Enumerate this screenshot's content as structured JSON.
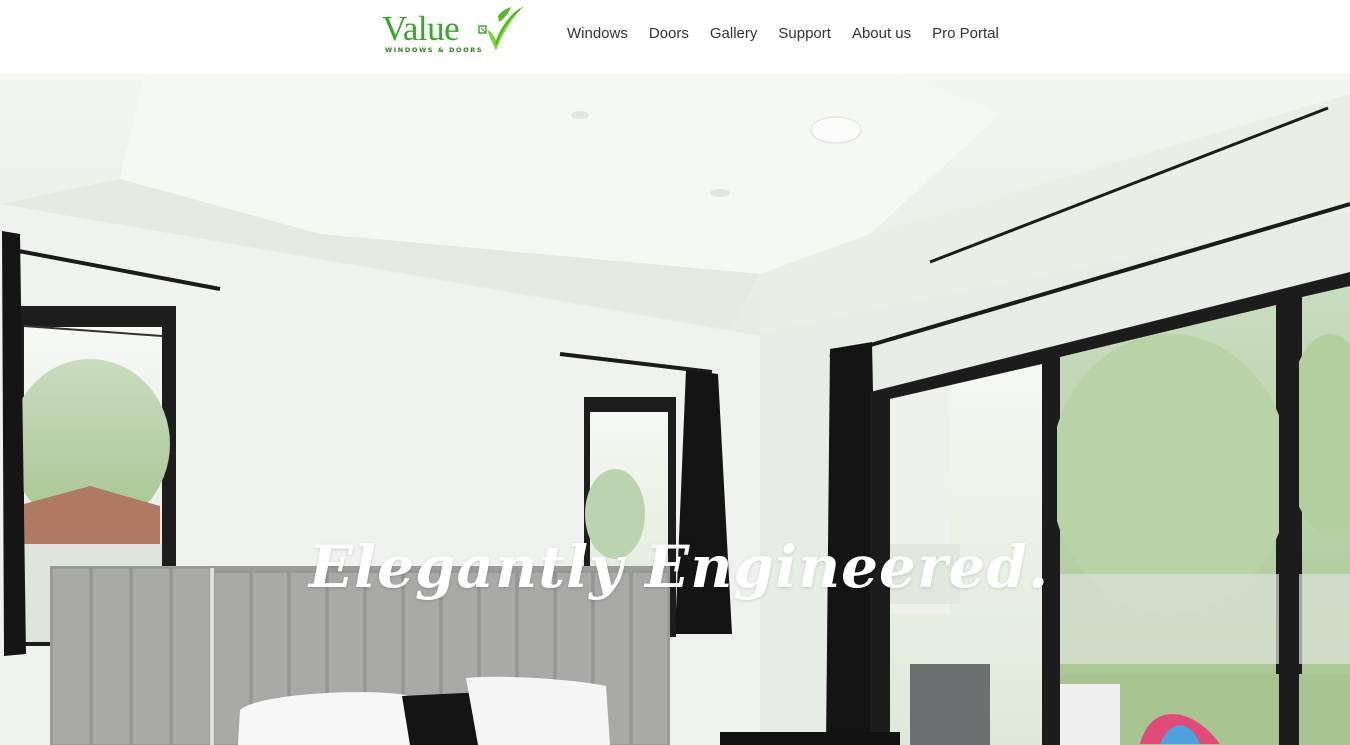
{
  "brand": {
    "name": "Value",
    "tagline": "WINDOWS & DOORS",
    "color": "#3aa629",
    "accent": "#7fd33a"
  },
  "nav": {
    "items": [
      {
        "label": "Windows"
      },
      {
        "label": "Doors"
      },
      {
        "label": "Gallery"
      },
      {
        "label": "Support"
      },
      {
        "label": "About us"
      },
      {
        "label": "Pro Portal"
      }
    ]
  },
  "hero": {
    "title": "Elegantly Engineered."
  }
}
